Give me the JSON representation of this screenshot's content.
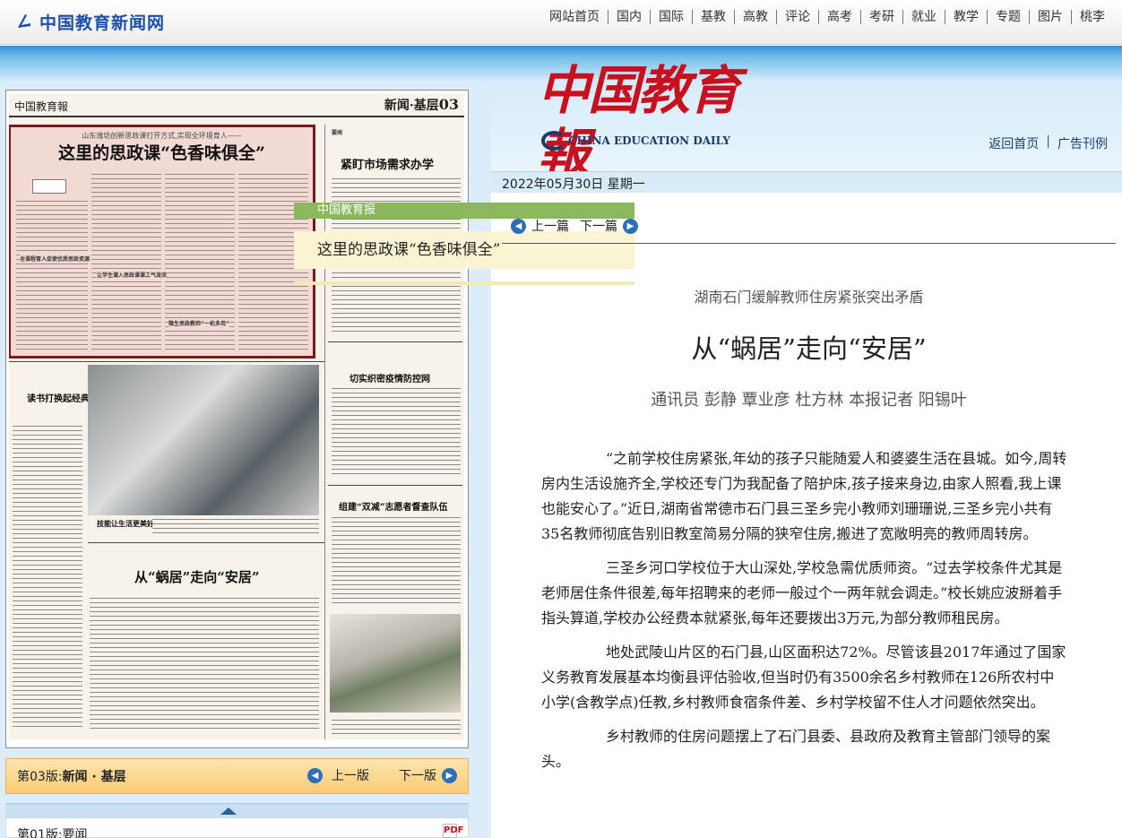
{
  "site": {
    "logo_text": "中国教育新闻网",
    "nav": [
      "网站首页",
      "国内",
      "国际",
      "基教",
      "高教",
      "评论",
      "高考",
      "考研",
      "就业",
      "教学",
      "专题",
      "图片",
      "桃李"
    ]
  },
  "banner": {
    "paper_name": "中国教育報",
    "paper_name_en": "CHINA EDUCATION DAILY",
    "links": [
      "返回首页",
      "广告刊例"
    ]
  },
  "date": "2022年05月30日  星期一",
  "article_nav": {
    "prev": "上一篇",
    "next": "下一篇"
  },
  "newspaper_page": {
    "masthead": "中国教育報",
    "section": "新闻·基层",
    "page_no": "03",
    "highlight_kicker": "山东潍坊创新思政课打开方式,实现全环境育人——",
    "highlight_title": "这里的思政课“色香味俱全”",
    "sub_headings": [
      "全课程育人促使优质思政资源",
      "让学生潜入思政课课工气泼浓",
      "微生思政教师“一机多用”"
    ],
    "story2_title": "紧盯市场需求办学",
    "story3_title": "切实织密疫情防控网",
    "story4_title": "读书打换起经典书目阅读风",
    "story5_title": "组建“双减”志愿者督查队伍",
    "photo_caption": "技能让生活更美好",
    "story6_title": "从“蜗居”走向“安居”"
  },
  "tooltip": {
    "source": "中国教育报",
    "title": "这里的思政课“色香味俱全”"
  },
  "pager": {
    "current_label": "第03版:",
    "current_name": "新闻 · 基层",
    "prev": "上一版",
    "next": "下一版",
    "version_item": "第01版:要闻",
    "pdf_label": "PDF"
  },
  "article": {
    "subtitle": "湖南石门缓解教师住房紧张突出矛盾",
    "title": "从“蜗居”走向“安居”",
    "author": "通讯员  彭静  覃业彦  杜方林  本报记者  阳锡叶",
    "paragraphs": [
      "“之前学校住房紧张,年幼的孩子只能随爱人和婆婆生活在县城。如今,周转房内生活设施齐全,学校还专门为我配备了陪护床,孩子接来身边,由家人照看,我上课也能安心了。”近日,湖南省常德市石门县三圣乡完小教师刘珊珊说,三圣乡完小共有35名教师彻底告别旧教室简易分隔的狭窄住房,搬进了宽敞明亮的教师周转房。",
      "三圣乡河口学校位于大山深处,学校急需优质师资。“过去学校条件尤其是老师居住条件很差,每年招聘来的老师一般过个一两年就会调走。”校长姚应波掰着手指头算道,学校办公经费本就紧张,每年还要拨出3万元,为部分教师租民房。",
      "地处武陵山片区的石门县,山区面积达72%。尽管该县2017年通过了国家义务教育发展基本均衡县评估验收,但当时仍有3500余名乡村教师在126所农村中小学(含教学点)任教,乡村教师食宿条件差、乡村学校留不住人才问题依然突出。",
      "乡村教师的住房问题摆上了石门县委、县政府及教育主管部门领导的案头。"
    ]
  }
}
